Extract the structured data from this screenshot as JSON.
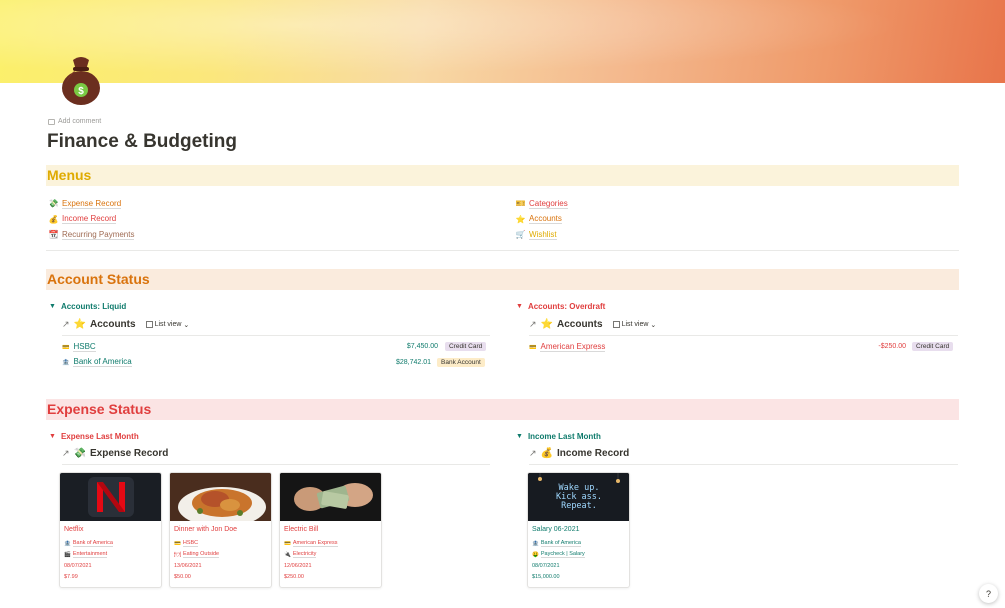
{
  "page": {
    "title": "Finance & Budgeting",
    "add_comment": "Add comment",
    "icon": "money-bag-icon"
  },
  "menus": {
    "heading": "Menus",
    "left": [
      {
        "icon": "money-wings-icon",
        "label": "Expense Record",
        "color": "#d9730d"
      },
      {
        "icon": "money-bag-icon",
        "label": "Income Record",
        "color": "#e03e3e"
      },
      {
        "icon": "calendar-icon",
        "label": "Recurring Payments",
        "color": "#9f6b53"
      }
    ],
    "right": [
      {
        "icon": "ticket-icon",
        "label": "Categories",
        "color": "#e03e3e"
      },
      {
        "icon": "star-icon",
        "label": "Accounts",
        "color": "#d9730d"
      },
      {
        "icon": "cart-icon",
        "label": "Wishlist",
        "color": "#dfab01"
      }
    ]
  },
  "account_status": {
    "heading": "Account Status",
    "liquid": {
      "toggle": "Accounts: Liquid",
      "db_title": "Accounts",
      "view": "List view",
      "rows": [
        {
          "name": "HSBC",
          "amount": "$7,450.00",
          "type": "Credit Card",
          "badge_color": "#e8deee"
        },
        {
          "name": "Bank of America",
          "amount": "$28,742.01",
          "type": "Bank Account",
          "badge_color": "#fdecc8"
        }
      ]
    },
    "overdraft": {
      "toggle": "Accounts: Overdraft",
      "db_title": "Accounts",
      "view": "List view",
      "rows": [
        {
          "name": "American Express",
          "amount": "-$250.00",
          "type": "Credit Card",
          "badge_color": "#e8deee"
        }
      ]
    }
  },
  "expense_status": {
    "heading": "Expense Status",
    "expense": {
      "toggle": "Expense Last Month",
      "db_title": "Expense Record",
      "cards": [
        {
          "title": "Netflix",
          "account": "Bank of America",
          "category": "Entertainment",
          "date": "08/07/2021",
          "amount": "$7.99"
        },
        {
          "title": "Dinner with Jon Doe",
          "account": "HSBC",
          "category": "Eating Outside",
          "date": "13/06/2021",
          "amount": "$50.00"
        },
        {
          "title": "Electric Bill",
          "account": "American Express",
          "category": "Electricity",
          "date": "12/06/2021",
          "amount": "$250.00"
        }
      ]
    },
    "income": {
      "toggle": "Income Last Month",
      "db_title": "Income Record",
      "cards": [
        {
          "title": "Salary 06-2021",
          "account": "Bank of America",
          "category": "Paycheck | Salary",
          "date": "08/07/2021",
          "amount": "$15,000.00",
          "image_text": "Wake up.\nKick ass.\nRepeat."
        }
      ]
    }
  },
  "help": "?",
  "colors": {
    "orange": "#d9730d",
    "red": "#e03e3e",
    "green": "#0f7b6c",
    "yellow": "#dfab01"
  }
}
